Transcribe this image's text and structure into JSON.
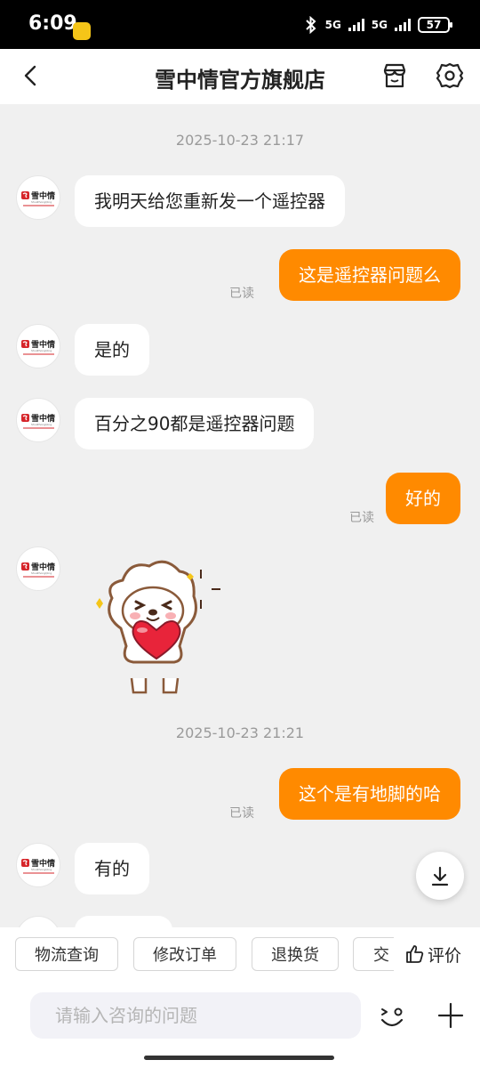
{
  "status_bar": {
    "time": "6:09",
    "network1": "5G",
    "network2": "5G",
    "battery": "57"
  },
  "header": {
    "title": "雪中情官方旗舰店"
  },
  "chat": {
    "messages": [
      {
        "type": "timestamp",
        "text": "2025-10-23 21:17"
      },
      {
        "type": "in",
        "text": "我明天给您重新发一个遥控器"
      },
      {
        "type": "out",
        "text": "这是遥控器问题么",
        "read": "已读"
      },
      {
        "type": "in",
        "text": "是的"
      },
      {
        "type": "in",
        "text": "百分之90都是遥控器问题"
      },
      {
        "type": "out",
        "text": "好的",
        "read": "已读"
      },
      {
        "type": "in-sticker",
        "sticker": "dog-holding-heart"
      },
      {
        "type": "timestamp",
        "text": "2025-10-23 21:21"
      },
      {
        "type": "out",
        "text": "这个是有地脚的哈",
        "read": "已读"
      },
      {
        "type": "in",
        "text": "有的"
      }
    ],
    "avatar_brand": "雪中情",
    "avatar_sub": "ShuiZhongQing"
  },
  "quick_actions": {
    "items": [
      "物流查询",
      "修改订单",
      "退换货",
      "交"
    ],
    "review_label": "评价"
  },
  "input": {
    "placeholder": "请输入咨询的问题"
  },
  "colors": {
    "accent": "#ff8a00",
    "background": "#f0f0f0"
  }
}
